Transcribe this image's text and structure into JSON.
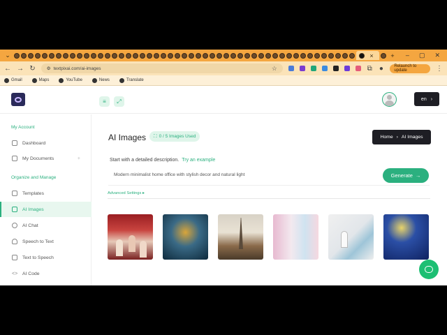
{
  "browser": {
    "url": "textpixai.com/ai-images",
    "relaunch_label": "Relaunch to update",
    "bookmarks": [
      "Gmail",
      "Maps",
      "YouTube",
      "News",
      "Translate"
    ]
  },
  "topbar": {
    "lang": "en"
  },
  "sidebar": {
    "section1": "My Account",
    "section2": "Organize and Manage",
    "items": [
      {
        "label": "Dashboard"
      },
      {
        "label": "My Documents"
      },
      {
        "label": "Templates"
      },
      {
        "label": "AI Images"
      },
      {
        "label": "AI Chat"
      },
      {
        "label": "Speech to Text"
      },
      {
        "label": "Text to Speech"
      },
      {
        "label": "AI Code"
      }
    ]
  },
  "main": {
    "title": "AI Images",
    "usage": "0 / 5 Images Used",
    "breadcrumb": {
      "home": "Home",
      "sep": "›",
      "current": "AI Images"
    },
    "hint": "Start with a detailed description.",
    "try_example": "Try an example",
    "prompt_value": "Modern minimalist home office with stylish decor and natural light",
    "generate_label": "Generate",
    "advanced_label": "Advanced Settings ▸"
  },
  "colors": {
    "accent": "#2bb07f",
    "dark": "#1e1e24",
    "browser_orange": "#f4a640"
  }
}
